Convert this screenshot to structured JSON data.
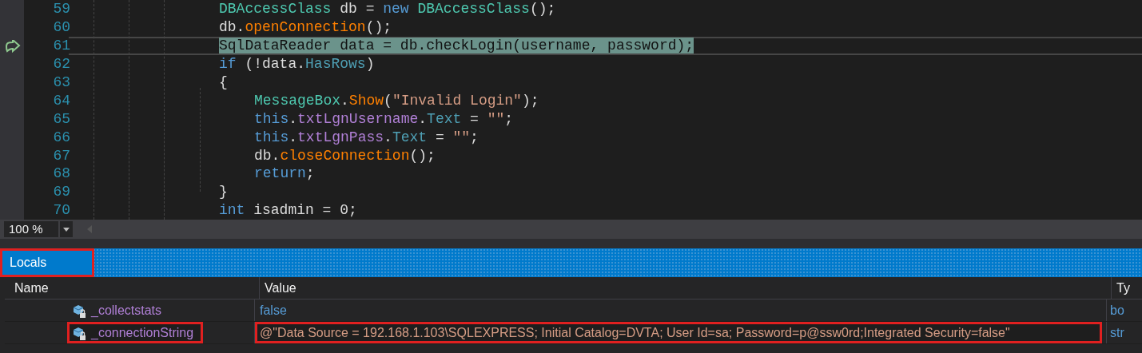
{
  "editor": {
    "lines": [
      {
        "number": "59",
        "current": false,
        "indented": false,
        "tokens": [
          {
            "text": "DBAccessClass",
            "kind": "type"
          },
          {
            "text": " db = ",
            "kind": "plain"
          },
          {
            "text": "new",
            "kind": "keyword"
          },
          {
            "text": " DBAccessClass",
            "kind": "type"
          },
          {
            "text": "();",
            "kind": "plain"
          }
        ]
      },
      {
        "number": "60",
        "current": false,
        "indented": false,
        "tokens": [
          {
            "text": "db.",
            "kind": "plain"
          },
          {
            "text": "openConnection",
            "kind": "method"
          },
          {
            "text": "();",
            "kind": "plain"
          }
        ]
      },
      {
        "number": "61",
        "current": true,
        "indented": false,
        "tokens": [
          {
            "text": "SqlDataReader data = db.checkLogin(username, password);",
            "kind": "plain"
          }
        ]
      },
      {
        "number": "62",
        "current": false,
        "indented": false,
        "tokens": [
          {
            "text": "if",
            "kind": "keyword"
          },
          {
            "text": " (!data.",
            "kind": "plain"
          },
          {
            "text": "HasRows",
            "kind": "property"
          },
          {
            "text": ")",
            "kind": "plain"
          }
        ]
      },
      {
        "number": "63",
        "current": false,
        "indented": false,
        "tokens": [
          {
            "text": "{",
            "kind": "plain"
          }
        ]
      },
      {
        "number": "64",
        "current": false,
        "indented": true,
        "tokens": [
          {
            "text": "MessageBox",
            "kind": "type"
          },
          {
            "text": ".",
            "kind": "plain"
          },
          {
            "text": "Show",
            "kind": "method"
          },
          {
            "text": "(",
            "kind": "plain"
          },
          {
            "text": "\"Invalid Login\"",
            "kind": "string"
          },
          {
            "text": ");",
            "kind": "plain"
          }
        ]
      },
      {
        "number": "65",
        "current": false,
        "indented": true,
        "tokens": [
          {
            "text": "this",
            "kind": "keyword"
          },
          {
            "text": ".",
            "kind": "plain"
          },
          {
            "text": "txtLgnUsername",
            "kind": "field"
          },
          {
            "text": ".",
            "kind": "plain"
          },
          {
            "text": "Text",
            "kind": "property"
          },
          {
            "text": " = ",
            "kind": "plain"
          },
          {
            "text": "\"\"",
            "kind": "string"
          },
          {
            "text": ";",
            "kind": "plain"
          }
        ]
      },
      {
        "number": "66",
        "current": false,
        "indented": true,
        "tokens": [
          {
            "text": "this",
            "kind": "keyword"
          },
          {
            "text": ".",
            "kind": "plain"
          },
          {
            "text": "txtLgnPass",
            "kind": "field"
          },
          {
            "text": ".",
            "kind": "plain"
          },
          {
            "text": "Text",
            "kind": "property"
          },
          {
            "text": " = ",
            "kind": "plain"
          },
          {
            "text": "\"\"",
            "kind": "string"
          },
          {
            "text": ";",
            "kind": "plain"
          }
        ]
      },
      {
        "number": "67",
        "current": false,
        "indented": true,
        "tokens": [
          {
            "text": "db.",
            "kind": "plain"
          },
          {
            "text": "closeConnection",
            "kind": "method"
          },
          {
            "text": "();",
            "kind": "plain"
          }
        ]
      },
      {
        "number": "68",
        "current": false,
        "indented": true,
        "tokens": [
          {
            "text": "return",
            "kind": "keyword"
          },
          {
            "text": ";",
            "kind": "plain"
          }
        ]
      },
      {
        "number": "69",
        "current": false,
        "indented": false,
        "tokens": [
          {
            "text": "}",
            "kind": "plain"
          }
        ]
      },
      {
        "number": "70",
        "current": false,
        "indented": false,
        "tokens": [
          {
            "text": "int",
            "kind": "keyword"
          },
          {
            "text": " isadmin = 0;",
            "kind": "plain"
          }
        ]
      }
    ]
  },
  "zoom": {
    "value": "100 %"
  },
  "locals": {
    "title": "Locals",
    "outlined": true,
    "columns": [
      "Name",
      "Value",
      "Ty"
    ],
    "rows": [
      {
        "name": "_collectstats",
        "value": "false",
        "type": "bo",
        "kind": "literal",
        "name_outlined": false,
        "value_outlined": false
      },
      {
        "name": "_connectionString",
        "value": "@\"Data Source = 192.168.1.103\\SQLEXPRESS; Initial Catalog=DVTA; User Id=sa; Password=p@ssw0rd;Integrated Security=false\"",
        "type": "str",
        "kind": "string",
        "name_outlined": true,
        "value_outlined": true
      }
    ]
  }
}
